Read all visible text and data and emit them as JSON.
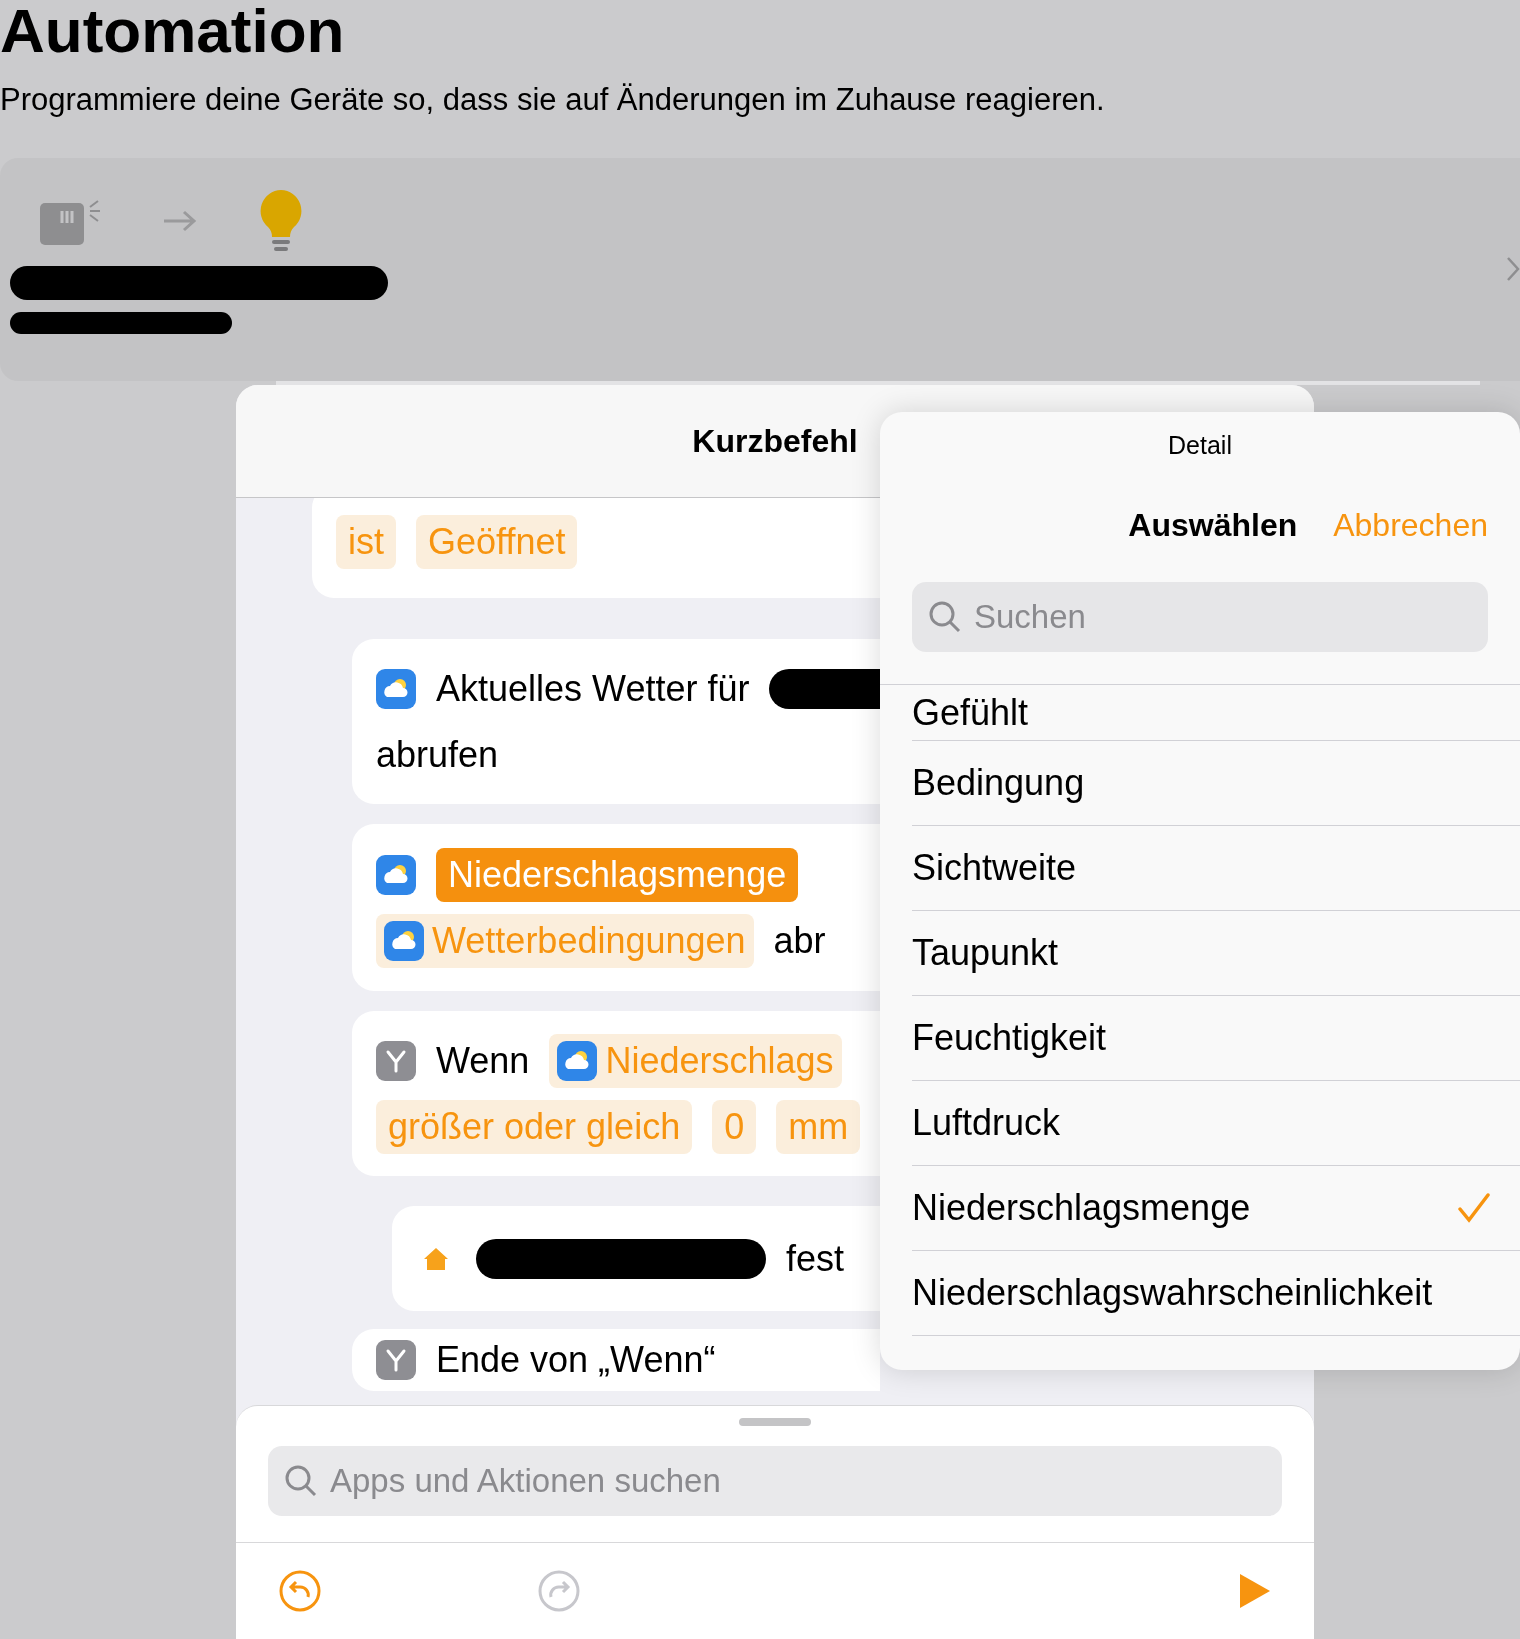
{
  "header": {
    "title": "Automation",
    "subtitle": "Programmiere deine Geräte so, dass sie auf Änderungen im Zuhause reagieren."
  },
  "sheet": {
    "title": "Kurzbefehl"
  },
  "actions": [
    {
      "lines": [
        [
          {
            "kind": "token",
            "text": "ist"
          },
          {
            "kind": "token",
            "text": "Geöffnet"
          }
        ]
      ]
    },
    {
      "lines": [
        [
          {
            "kind": "weather-icon"
          },
          {
            "kind": "text",
            "text": "Aktuelles Wetter für"
          },
          {
            "kind": "redacted"
          }
        ],
        [
          {
            "kind": "text",
            "text": "abrufen"
          }
        ]
      ]
    },
    {
      "lines": [
        [
          {
            "kind": "weather-icon"
          },
          {
            "kind": "token-filled",
            "text": "Niederschlagsmenge"
          }
        ],
        [
          {
            "kind": "token-weather",
            "text": "Wetterbedingungen"
          },
          {
            "kind": "text",
            "text": "abr"
          }
        ]
      ]
    },
    {
      "lines": [
        [
          {
            "kind": "branch-icon"
          },
          {
            "kind": "text",
            "text": "Wenn"
          },
          {
            "kind": "token-weather",
            "text": "Niederschlags"
          }
        ],
        [
          {
            "kind": "token",
            "text": "größer oder gleich"
          },
          {
            "kind": "token",
            "text": "0"
          },
          {
            "kind": "token",
            "text": "mm"
          }
        ]
      ],
      "children": [
        {
          "lines": [
            [
              {
                "kind": "home-icon"
              },
              {
                "kind": "redacted"
              },
              {
                "kind": "text",
                "text": "fest"
              }
            ]
          ]
        }
      ]
    },
    {
      "lines": [
        [
          {
            "kind": "branch-icon"
          },
          {
            "kind": "text",
            "text": "Ende von „Wenn“"
          }
        ]
      ]
    }
  ],
  "popover": {
    "title": "Detail",
    "confirm": "Auswählen",
    "cancel": "Abbrechen",
    "search_placeholder": "Suchen",
    "items": [
      {
        "label": "Gefühlt",
        "selected": false
      },
      {
        "label": "Bedingung",
        "selected": false
      },
      {
        "label": "Sichtweite",
        "selected": false
      },
      {
        "label": "Taupunkt",
        "selected": false
      },
      {
        "label": "Feuchtigkeit",
        "selected": false
      },
      {
        "label": "Luftdruck",
        "selected": false
      },
      {
        "label": "Niederschlagsmenge",
        "selected": true
      },
      {
        "label": "Niederschlagswahrscheinlichkeit",
        "selected": false
      }
    ]
  },
  "bottom": {
    "search_placeholder": "Apps und Aktionen suchen",
    "undo": {
      "disabled": false
    },
    "redo": {
      "disabled": true
    }
  }
}
